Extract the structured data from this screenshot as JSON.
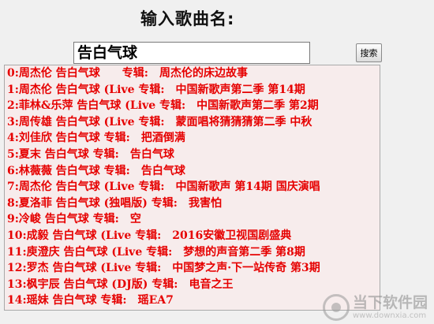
{
  "header": {
    "title": "输入歌曲名:"
  },
  "search": {
    "value": "告白气球",
    "button_label": "搜索"
  },
  "results": [
    "0:周杰伦 告白气球　　专辑:　周杰伦的床边故事",
    "1:周杰伦 告白气球 (Live 专辑:　中国新歌声第二季 第14期",
    "2:菲林&乐萍 告白气球 (Live 专辑:　中国新歌声第二季 第2期",
    "3:周传雄 告白气球 (Live 专辑:　蒙面唱将猜猜猜第二季 中秋",
    "4:刘佳欣 告白气球 专辑:　把酒倒满",
    "5:夏末 告白气球 专辑:　告白气球",
    "6:林薇薇 告白气球 专辑:　告白气球",
    "7:周杰伦 告白气球 (Live 专辑:　中国新歌声 第14期 国庆演唱",
    "8:夏洛菲 告白气球 (独唱版) 专辑:　我害怕",
    "9:冷峻 告白气球 专辑:　空",
    "10:成毅 告白气球 (Live 专辑:　2016安徽卫视国剧盛典",
    "11:庾澄庆 告白气球 (Live 专辑:　梦想的声音第二季 第8期",
    "12:罗杰 告白气球 (Live 专辑:　中国梦之声·下一站传奇 第3期",
    "13:枫宇辰 告白气球 (DJ版) 专辑:　电音之王",
    "14:瑶妹 告白气球 专辑:　瑶EA7"
  ],
  "watermark": {
    "name": "当下软件园",
    "url": "www.downxia.com"
  },
  "colors": {
    "result_text": "#e60000",
    "list_background": "#f7ecec"
  }
}
